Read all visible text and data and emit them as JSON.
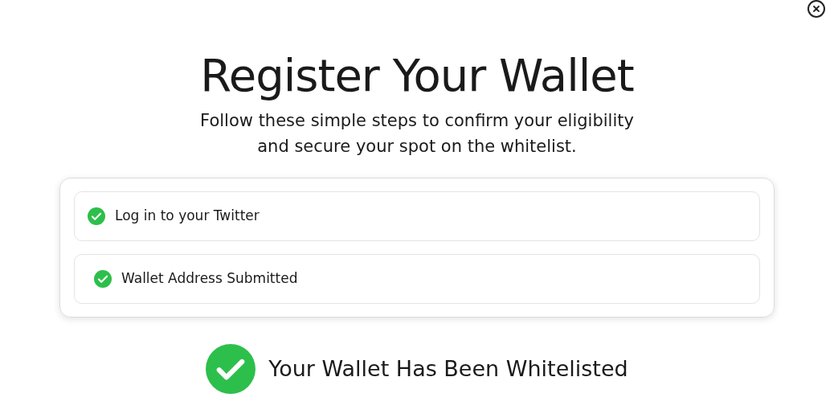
{
  "title": "Register Your Wallet",
  "subtitle_lines": [
    "Follow these simple steps to confirm your eligibility",
    "and secure your spot on the whitelist."
  ],
  "steps": [
    {
      "label": "Log in to your Twitter",
      "done": true
    },
    {
      "label": "Wallet Address Submitted",
      "done": true
    }
  ],
  "result": {
    "label": "Your Wallet Has Been Whitelisted",
    "done": true
  }
}
